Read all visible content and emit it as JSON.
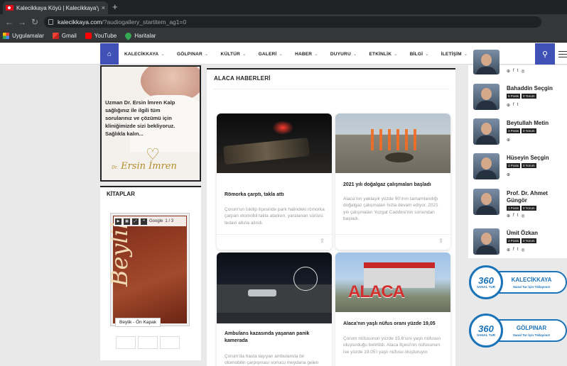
{
  "browser": {
    "tab_title": "Kalecikkaya Köyü | Kalecikkaya'y",
    "tab_close": "×",
    "new_tab": "+",
    "url_host": "kalecikkaya.com",
    "url_path": "/?audiogallery_startitem_ag1=0",
    "back": "←",
    "forward": "→",
    "reload": "↻",
    "bookmarks": [
      "Uygulamalar",
      "Gmail",
      "YouTube",
      "Haritalar"
    ]
  },
  "nav": {
    "home_icon": "⌂",
    "search_icon": "⚲",
    "caret": "⌄",
    "items": [
      "KALECİKKAYA",
      "GÖLPINAR",
      "KÜLTÜR",
      "GALERİ",
      "HABER",
      "DUYURU",
      "ETKİNLİK",
      "BİLGİ",
      "İLETİŞİM"
    ]
  },
  "ad": {
    "text": "Uzman Dr. Ersin İmren Kalp sağlığınız ile ilgili tüm sorularınız ve çözümü için kliniğimizde sizi bekliyoruz. Sağlıkla kalın...",
    "logo_prefix": "Dr.",
    "logo_name": "Ersin İmren"
  },
  "books_widget": {
    "title": "KİTAPLAR",
    "book_title": "Beylik",
    "caption": "Beylik - Ön Kapak",
    "page_counter": "1 / 3",
    "brand": "Google"
  },
  "main": {
    "section_title": "ALACA HABERLERİ",
    "share_icon": "⇪",
    "cards": [
      {
        "title": "Römorka çarptı, takla attı",
        "desc": "Çorum'un İskilip ilçesinde park halindeki römorka çarpan otomobil takla atarken, yaralanan sürücü tedavi altına alındı."
      },
      {
        "title": "2021 yılı doğalgaz çalışmaları başladı",
        "desc": "Alaca'nın yaklaşık yüzde 90'ının tamamlandığı doğalgaz çalışmaları hızla devam ediyor. 2021 yılı çalışmaları Yozgat Caddesi'nin sonundan başladı."
      },
      {
        "title": "Ambulans kazasında yaşanan panik kamerada",
        "desc": "Çorum'da hasta taşıyan ambulansla bir otomobilin çarpışması sonucu meydana gelen"
      },
      {
        "title": "Alaca'nın yaşlı nüfus oranı yüzde 19,05",
        "desc": "Çorum nüfusunun yüzde 15.6'sını yaşlı nüfusun oluşturduğu belirtildi. Alaca İlçesi'nin nüfusunun ise yüzde 19.05'i yaşlı nüfusu oluşturuyor.",
        "image_sign": "ALACA"
      }
    ]
  },
  "authors": {
    "social_icons": [
      "⊕",
      "f",
      "t",
      "◎"
    ],
    "list": [
      {
        "name": "Bahaddin Seçgin",
        "posts": "5 Posts",
        "comments": "0 Yorum"
      },
      {
        "name": "Beytullah Metin",
        "posts": "3 Posts",
        "comments": "0 Yorum"
      },
      {
        "name": "Hüseyin Seçgin",
        "posts": "3 Posts",
        "comments": "0 Yorum"
      },
      {
        "name": "Prof. Dr. Ahmet Güngör",
        "posts": "1 Posts",
        "comments": "0 Yorum"
      },
      {
        "name": "Ümit Özkan",
        "posts": "3 Posts",
        "comments": "0 Yorum"
      }
    ]
  },
  "tours": [
    {
      "num": "360",
      "sub": "SANAL TUR",
      "name": "KALECİKKAYA",
      "tag": "Sanal Tur İçin Tıklayınız!"
    },
    {
      "num": "360",
      "sub": "SANAL TUR",
      "name": "GÖLPINAR",
      "tag": "Sanal Tur İçin Tıklayınız!"
    }
  ]
}
